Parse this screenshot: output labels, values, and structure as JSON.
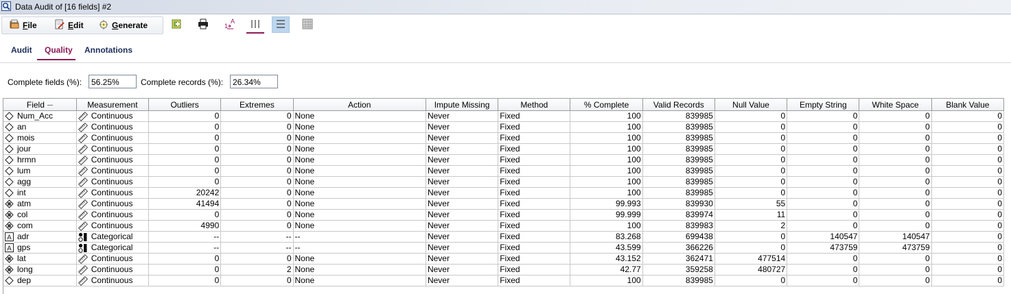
{
  "window": {
    "title": "Data Audit of [16 fields] #2"
  },
  "toolbar": {
    "menus": [
      {
        "label": "File",
        "icon": "folder-icon"
      },
      {
        "label": "Edit",
        "icon": "edit-icon"
      },
      {
        "label": "Generate",
        "icon": "generate-icon"
      }
    ],
    "tools": [
      "generate-node-icon",
      "print-icon",
      "sort-icon",
      "columns-view-icon",
      "rows-view-icon",
      "grid-view-icon"
    ]
  },
  "tabs": [
    {
      "label": "Audit",
      "active": false
    },
    {
      "label": "Quality",
      "active": true
    },
    {
      "label": "Annotations",
      "active": false
    }
  ],
  "summary": {
    "complete_fields_label": "Complete fields (%):",
    "complete_fields_value": "56.25%",
    "complete_records_label": "Complete records (%):",
    "complete_records_value": "26.34%"
  },
  "table": {
    "columns": [
      "Field",
      "Measurement",
      "Outliers",
      "Extremes",
      "Action",
      "Impute Missing",
      "Method",
      "% Complete",
      "Valid Records",
      "Null Value",
      "Empty String",
      "White Space",
      "Blank Value"
    ],
    "rows": [
      {
        "field": "Num_Acc",
        "ficon": "diamond",
        "measurement": "Continuous",
        "outliers": "0",
        "extremes": "0",
        "action": "None",
        "impute": "Never",
        "method": "Fixed",
        "complete": "100",
        "valid": "839985",
        "null": "0",
        "empty": "0",
        "white": "0",
        "blank": "0"
      },
      {
        "field": "an",
        "ficon": "diamond",
        "measurement": "Continuous",
        "outliers": "0",
        "extremes": "0",
        "action": "None",
        "impute": "Never",
        "method": "Fixed",
        "complete": "100",
        "valid": "839985",
        "null": "0",
        "empty": "0",
        "white": "0",
        "blank": "0"
      },
      {
        "field": "mois",
        "ficon": "diamond",
        "measurement": "Continuous",
        "outliers": "0",
        "extremes": "0",
        "action": "None",
        "impute": "Never",
        "method": "Fixed",
        "complete": "100",
        "valid": "839985",
        "null": "0",
        "empty": "0",
        "white": "0",
        "blank": "0"
      },
      {
        "field": "jour",
        "ficon": "diamond",
        "measurement": "Continuous",
        "outliers": "0",
        "extremes": "0",
        "action": "None",
        "impute": "Never",
        "method": "Fixed",
        "complete": "100",
        "valid": "839985",
        "null": "0",
        "empty": "0",
        "white": "0",
        "blank": "0"
      },
      {
        "field": "hrmn",
        "ficon": "diamond",
        "measurement": "Continuous",
        "outliers": "0",
        "extremes": "0",
        "action": "None",
        "impute": "Never",
        "method": "Fixed",
        "complete": "100",
        "valid": "839985",
        "null": "0",
        "empty": "0",
        "white": "0",
        "blank": "0"
      },
      {
        "field": "lum",
        "ficon": "diamond",
        "measurement": "Continuous",
        "outliers": "0",
        "extremes": "0",
        "action": "None",
        "impute": "Never",
        "method": "Fixed",
        "complete": "100",
        "valid": "839985",
        "null": "0",
        "empty": "0",
        "white": "0",
        "blank": "0"
      },
      {
        "field": "agg",
        "ficon": "diamond",
        "measurement": "Continuous",
        "outliers": "0",
        "extremes": "0",
        "action": "None",
        "impute": "Never",
        "method": "Fixed",
        "complete": "100",
        "valid": "839985",
        "null": "0",
        "empty": "0",
        "white": "0",
        "blank": "0"
      },
      {
        "field": "int",
        "ficon": "diamond",
        "measurement": "Continuous",
        "outliers": "20242",
        "extremes": "0",
        "action": "None",
        "impute": "Never",
        "method": "Fixed",
        "complete": "100",
        "valid": "839985",
        "null": "0",
        "empty": "0",
        "white": "0",
        "blank": "0"
      },
      {
        "field": "atm",
        "ficon": "diamond-filled",
        "measurement": "Continuous",
        "outliers": "41494",
        "extremes": "0",
        "action": "None",
        "impute": "Never",
        "method": "Fixed",
        "complete": "99.993",
        "valid": "839930",
        "null": "55",
        "empty": "0",
        "white": "0",
        "blank": "0"
      },
      {
        "field": "col",
        "ficon": "diamond-filled",
        "measurement": "Continuous",
        "outliers": "0",
        "extremes": "0",
        "action": "None",
        "impute": "Never",
        "method": "Fixed",
        "complete": "99.999",
        "valid": "839974",
        "null": "11",
        "empty": "0",
        "white": "0",
        "blank": "0"
      },
      {
        "field": "com",
        "ficon": "diamond-filled",
        "measurement": "Continuous",
        "outliers": "4990",
        "extremes": "0",
        "action": "None",
        "impute": "Never",
        "method": "Fixed",
        "complete": "100",
        "valid": "839983",
        "null": "2",
        "empty": "0",
        "white": "0",
        "blank": "0"
      },
      {
        "field": "adr",
        "ficon": "string",
        "measurement": "Categorical",
        "outliers": "--",
        "extremes": "--",
        "action": "--",
        "impute": "Never",
        "method": "Fixed",
        "complete": "83.268",
        "valid": "699438",
        "null": "0",
        "empty": "140547",
        "white": "140547",
        "blank": "0"
      },
      {
        "field": "gps",
        "ficon": "string",
        "measurement": "Categorical",
        "outliers": "--",
        "extremes": "--",
        "action": "--",
        "impute": "Never",
        "method": "Fixed",
        "complete": "43.599",
        "valid": "366226",
        "null": "0",
        "empty": "473759",
        "white": "473759",
        "blank": "0"
      },
      {
        "field": "lat",
        "ficon": "diamond-filled",
        "measurement": "Continuous",
        "outliers": "0",
        "extremes": "0",
        "action": "None",
        "impute": "Never",
        "method": "Fixed",
        "complete": "43.152",
        "valid": "362471",
        "null": "477514",
        "empty": "0",
        "white": "0",
        "blank": "0"
      },
      {
        "field": "long",
        "ficon": "diamond-filled",
        "measurement": "Continuous",
        "outliers": "0",
        "extremes": "2",
        "action": "None",
        "impute": "Never",
        "method": "Fixed",
        "complete": "42.77",
        "valid": "359258",
        "null": "480727",
        "empty": "0",
        "white": "0",
        "blank": "0"
      },
      {
        "field": "dep",
        "ficon": "diamond",
        "measurement": "Continuous",
        "outliers": "0",
        "extremes": "0",
        "action": "None",
        "impute": "Never",
        "method": "Fixed",
        "complete": "100",
        "valid": "839985",
        "null": "0",
        "empty": "0",
        "white": "0",
        "blank": "0"
      }
    ]
  },
  "colors": {
    "accent": "#8a1a55",
    "header_bg": "#eef0f3",
    "grid_line": "#c8c8c8",
    "active_tool": "#bcd6ee"
  }
}
